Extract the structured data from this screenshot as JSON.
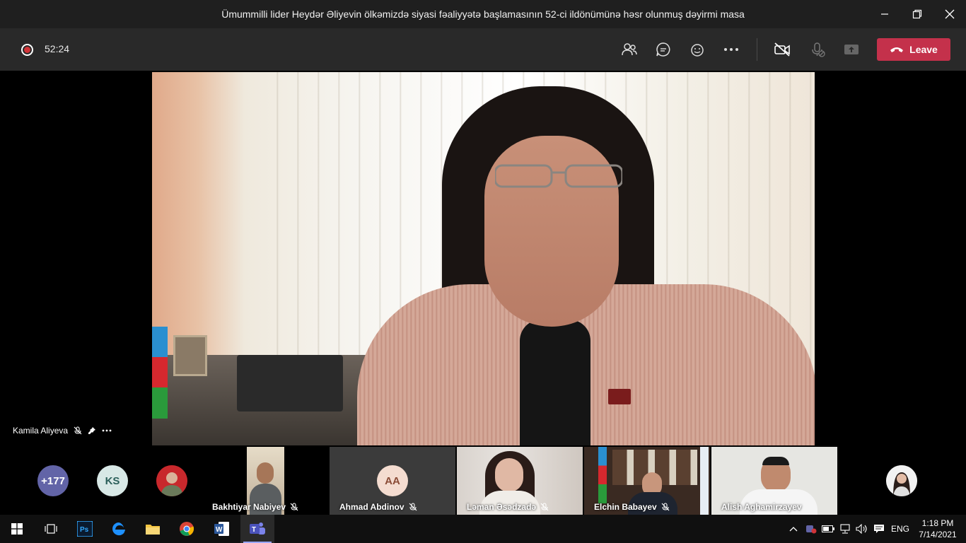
{
  "window": {
    "title": "Ümummilli lider Heydər Əliyevin ölkəmizdə siyasi fəaliyyətə başlamasının 52-ci ildönümünə həsr olunmuş dəyirmi masa"
  },
  "toolbar": {
    "recording_timer": "52:24",
    "leave_label": "Leave"
  },
  "stage": {
    "speaker_name": "Kamila Aliyeva"
  },
  "strip": {
    "overflow_count": "+177",
    "avatars": [
      {
        "initials": "KS",
        "bg": "#d8e8e6",
        "fg": "#2b5f5a"
      }
    ],
    "tiles": [
      {
        "name": "Bakhtiyar Nabiyev"
      },
      {
        "name": "Ahmad Abdinov",
        "initials": "AA"
      },
      {
        "name": "Ləman Əsədzadə"
      },
      {
        "name": "Elchin Babayev"
      },
      {
        "name": "Alish Aghamirzayev"
      }
    ]
  },
  "taskbar": {
    "language": "ENG",
    "time": "1:18 PM",
    "date": "7/14/2021"
  },
  "colors": {
    "leave": "#c4314b",
    "overflow_avatar": "#6264a7",
    "toolbar": "#292929",
    "titlebar": "#1f1f1f"
  }
}
